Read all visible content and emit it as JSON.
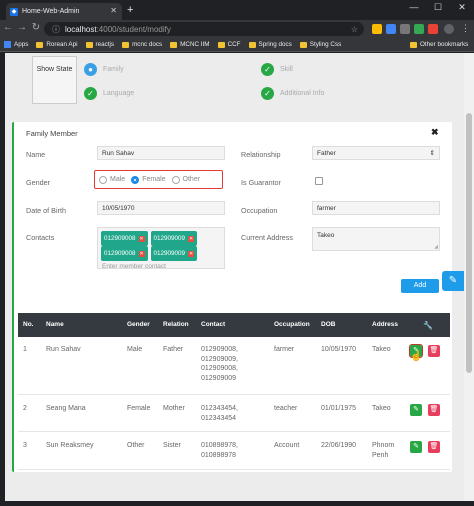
{
  "browser": {
    "tab_title": "Home-Web-Admin",
    "tab_icon": "app-icon",
    "url_host": "localhost",
    "url_path": ":4000/student/modify",
    "bookmarks": [
      {
        "label": "Apps",
        "icon": "apps-icon"
      },
      {
        "label": "Rorean Api",
        "icon": "folder-icon"
      },
      {
        "label": "reactjs",
        "icon": "folder-icon"
      },
      {
        "label": "mcnc docs",
        "icon": "folder-icon"
      },
      {
        "label": "MCNC IIM",
        "icon": "folder-icon"
      },
      {
        "label": "CCF",
        "icon": "folder-icon"
      },
      {
        "label": "Spring docs",
        "icon": "folder-icon"
      },
      {
        "label": "Styling Css",
        "icon": "folder-icon"
      }
    ],
    "other_bookmarks": "Other bookmarks"
  },
  "steps": {
    "show_state": "Show State",
    "items": [
      {
        "label": "Family",
        "state": "active"
      },
      {
        "label": "Skill",
        "state": "done"
      },
      {
        "label": "Language",
        "state": "done"
      },
      {
        "label": "Additional Info",
        "state": "done"
      }
    ]
  },
  "form": {
    "title": "Family Member",
    "name_label": "Name",
    "name_value": "Run Sahav",
    "relationship_label": "Relationship",
    "relationship_value": "Father",
    "gender_label": "Gender",
    "gender_options": [
      "Male",
      "Female",
      "Other"
    ],
    "gender_selected": "Female",
    "guarantor_label": "Is Guarantor",
    "dob_label": "Date of Birth",
    "dob_value": "10/05/1970",
    "occupation_label": "Occupation",
    "occupation_value": "farmer",
    "contacts_label": "Contacts",
    "contacts": [
      "012909008",
      "012909009",
      "012909008",
      "012909009"
    ],
    "contact_placeholder": "Enter member contact",
    "address_label": "Current Address",
    "address_value": "Takeo",
    "add_button": "Add"
  },
  "table": {
    "headers": [
      "No.",
      "Name",
      "Gender",
      "Relation",
      "Contact",
      "Occupation",
      "DOB",
      "Address"
    ],
    "rows": [
      {
        "no": "1",
        "name": "Run Sahav",
        "gender": "Male",
        "relation": "Father",
        "contact": "012909008,\n012909009,\n012909008,\n012909009",
        "occupation": "farmer",
        "dob": "10/05/1970",
        "address": "Takeo"
      },
      {
        "no": "2",
        "name": "Seang Mana",
        "gender": "Female",
        "relation": "Mother",
        "contact": "012343454,\n012343454",
        "occupation": "teacher",
        "dob": "01/01/1975",
        "address": "Takeo"
      },
      {
        "no": "3",
        "name": "Sun Reaksmey",
        "gender": "Other",
        "relation": "Sister",
        "contact": "010898978,\n010898978",
        "occupation": "Account",
        "dob": "22/06/1990",
        "address": "Phnom\nPenh"
      }
    ]
  },
  "colors": {
    "success": "#28a745",
    "primary": "#1e9be9",
    "danger": "#e83e5d",
    "highlight": "#e53935",
    "table_header": "#343a40"
  }
}
